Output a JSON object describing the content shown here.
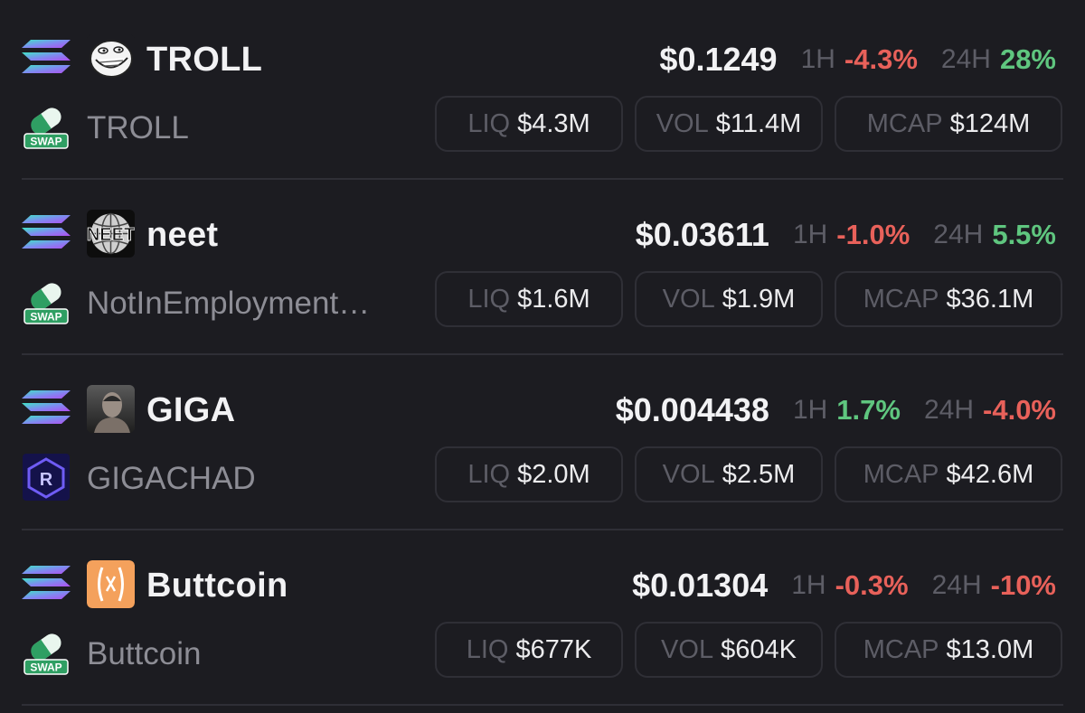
{
  "colors": {
    "background": "#1c1c21",
    "negative": "#e8615a",
    "positive": "#5fc67f",
    "muted": "#5d5d66"
  },
  "tokens": [
    {
      "symbol": "TROLL",
      "name": "TROLL",
      "chain_icon": "solana-icon",
      "token_icon": "troll-face-icon",
      "dex_icon": "swap-icon",
      "dex_label": "SWAP",
      "price": "$0.1249",
      "h1_label": "1H",
      "h1_change": "-4.3%",
      "h1_dir": "neg",
      "h24_label": "24H",
      "h24_change": "28%",
      "h24_dir": "pos",
      "liq_label": "LIQ",
      "liq": "$4.3M",
      "vol_label": "VOL",
      "vol": "$11.4M",
      "mcap_label": "MCAP",
      "mcap": "$124M"
    },
    {
      "symbol": "neet",
      "name": "NotInEmployment…",
      "chain_icon": "solana-icon",
      "token_icon": "neet-globe-icon",
      "token_icon_text": "NEET",
      "dex_icon": "swap-icon",
      "dex_label": "SWAP",
      "price": "$0.03611",
      "h1_label": "1H",
      "h1_change": "-1.0%",
      "h1_dir": "neg",
      "h24_label": "24H",
      "h24_change": "5.5%",
      "h24_dir": "pos",
      "liq_label": "LIQ",
      "liq": "$1.6M",
      "vol_label": "VOL",
      "vol": "$1.9M",
      "mcap_label": "MCAP",
      "mcap": "$36.1M"
    },
    {
      "symbol": "GIGA",
      "name": "GIGACHAD",
      "chain_icon": "solana-icon",
      "token_icon": "gigachad-portrait-icon",
      "dex_icon": "raydium-icon",
      "price": "$0.004438",
      "h1_label": "1H",
      "h1_change": "1.7%",
      "h1_dir": "pos",
      "h24_label": "24H",
      "h24_change": "-4.0%",
      "h24_dir": "neg",
      "liq_label": "LIQ",
      "liq": "$2.0M",
      "vol_label": "VOL",
      "vol": "$2.5M",
      "mcap_label": "MCAP",
      "mcap": "$42.6M"
    },
    {
      "symbol": "Buttcoin",
      "name": "Buttcoin",
      "chain_icon": "solana-icon",
      "token_icon": "buttcoin-icon",
      "dex_icon": "swap-icon",
      "dex_label": "SWAP",
      "price": "$0.01304",
      "h1_label": "1H",
      "h1_change": "-0.3%",
      "h1_dir": "neg",
      "h24_label": "24H",
      "h24_change": "-10%",
      "h24_dir": "neg",
      "liq_label": "LIQ",
      "liq": "$677K",
      "vol_label": "VOL",
      "vol": "$604K",
      "mcap_label": "MCAP",
      "mcap": "$13.0M"
    }
  ]
}
